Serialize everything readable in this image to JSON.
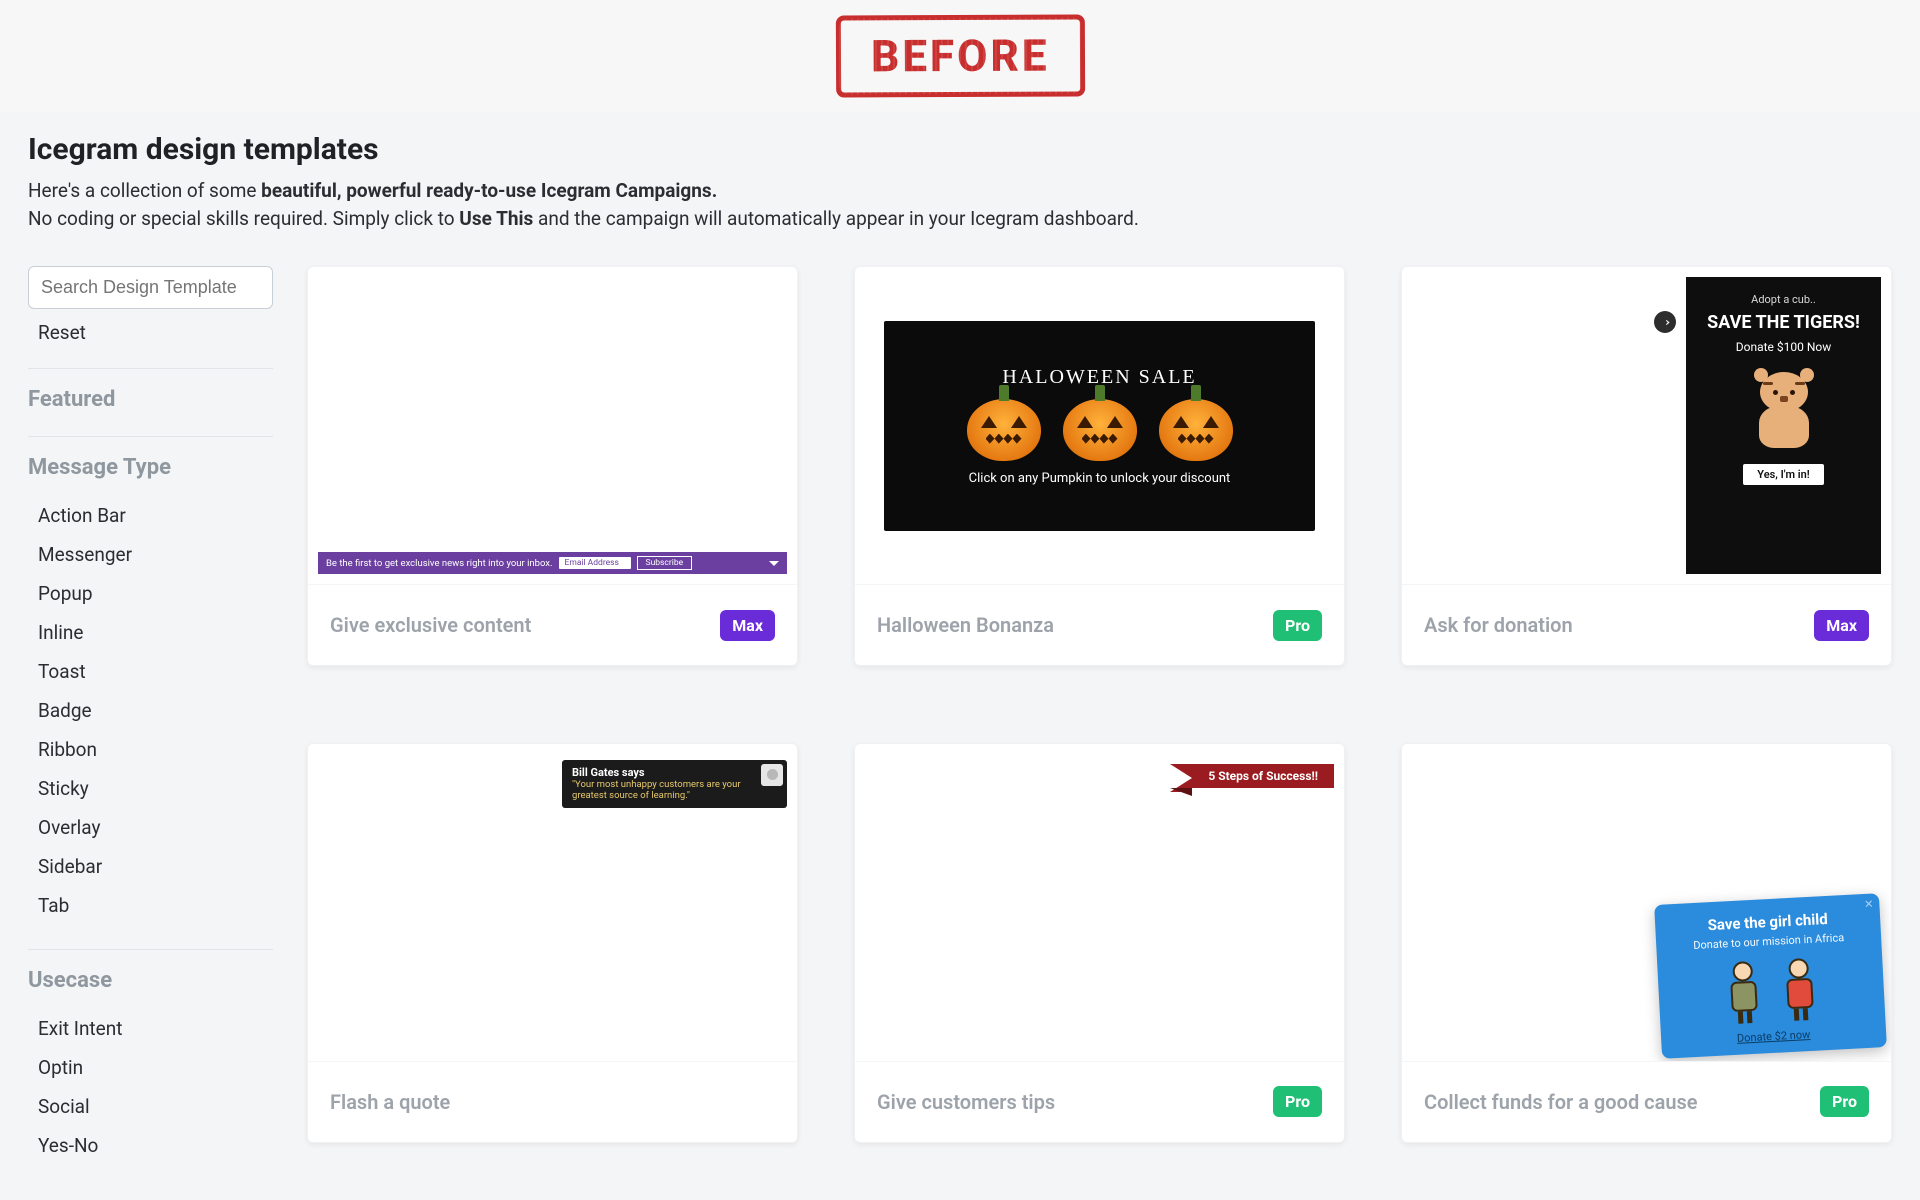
{
  "banner": {
    "text": "BEFORE"
  },
  "page": {
    "title": "Icegram design templates",
    "intro_pre": "Here's a collection of some ",
    "intro_strong1": "beautiful, powerful ready-to-use Icegram Campaigns.",
    "intro_line2_pre": "No coding or special skills required. Simply click to ",
    "intro_strong2": "Use This",
    "intro_line2_post": " and the campaign will automatically appear in your Icegram dashboard."
  },
  "sidebar": {
    "search_placeholder": "Search Design Template",
    "reset": "Reset",
    "featured_heading": "Featured",
    "message_type_heading": "Message Type",
    "message_types": [
      "Action Bar",
      "Messenger",
      "Popup",
      "Inline",
      "Toast",
      "Badge",
      "Ribbon",
      "Sticky",
      "Overlay",
      "Sidebar",
      "Tab"
    ],
    "usecase_heading": "Usecase",
    "usecases": [
      "Exit Intent",
      "Optin",
      "Social",
      "Yes-No"
    ]
  },
  "badges": {
    "max": "Max",
    "pro": "Pro"
  },
  "cards": [
    {
      "title": "Give exclusive content",
      "tier": "max",
      "preview": {
        "bar_text": "Be the first to get exclusive news right into your inbox.",
        "bar_placeholder": "Email Address",
        "bar_button": "Subscribe"
      }
    },
    {
      "title": "Halloween Bonanza",
      "tier": "pro",
      "preview": {
        "banner_title": "HALOWEEN SALE",
        "caption": "Click on any Pumpkin to unlock your discount"
      }
    },
    {
      "title": "Ask for donation",
      "tier": "max",
      "preview": {
        "subtitle": "Adopt a cub..",
        "headline": "SAVE THE TIGERS!",
        "donate": "Donate $100 Now",
        "cta": "Yes, I'm in!"
      }
    },
    {
      "title": "Flash a quote",
      "tier": "",
      "preview": {
        "author": "Bill Gates says",
        "quote": "\"Your most unhappy customers are your greatest source of learning.\""
      }
    },
    {
      "title": "Give customers tips",
      "tier": "pro",
      "preview": {
        "ribbon_text": "5 Steps of Success!!"
      }
    },
    {
      "title": "Collect funds for a good cause",
      "tier": "pro",
      "preview": {
        "popup_title": "Save the girl child",
        "popup_sub": "Donate to our mission in Africa",
        "popup_link": "Donate $2 now"
      }
    }
  ]
}
